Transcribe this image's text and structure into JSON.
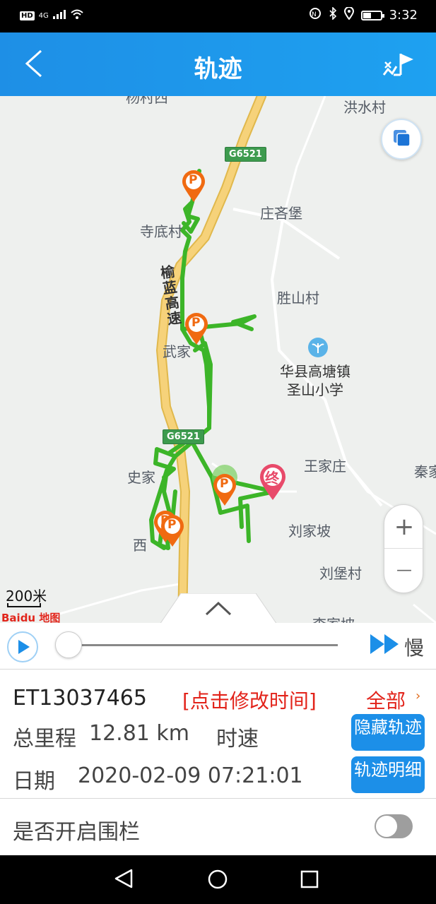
{
  "status_bar": {
    "left_badge": "HD",
    "network": "4G",
    "time": "3:32"
  },
  "header": {
    "title": "轨迹"
  },
  "map": {
    "road_code_1": "G6521",
    "road_code_2": "G6521",
    "highway_name": "榆蓝高速",
    "places": [
      {
        "name": "洪水村"
      },
      {
        "name": "庄吝堡"
      },
      {
        "name": "寺底村"
      },
      {
        "name": "胜山村"
      },
      {
        "name": "武家"
      },
      {
        "name": "华县高塘镇"
      },
      {
        "name": "圣山小学"
      },
      {
        "name": "史家"
      },
      {
        "name": "王家庄"
      },
      {
        "name": "秦家"
      },
      {
        "name": "刘家坡"
      },
      {
        "name": "西"
      },
      {
        "name": "刘堡村"
      },
      {
        "name": "李家坡"
      },
      {
        "name": "杨村西"
      }
    ],
    "scale": "200米",
    "logo": "Baidu 地图",
    "zoom_in": "+",
    "zoom_out": "—",
    "parking_marker": "P",
    "end_marker": "终",
    "track_color": "#3cb528",
    "parking_color": "#f06a11",
    "end_color": "#e84a6a"
  },
  "playback": {
    "speed_label": "慢",
    "progress": 0
  },
  "info": {
    "device_id": "ET13037465",
    "edit_time": "[点击修改时间]",
    "all_link": "全部",
    "mileage_label": "总里程",
    "mileage_value": "12.81 km",
    "speed_label": "时速",
    "date_label": "日期",
    "date_value": "2020-02-09 07:21:01",
    "hide_track_button": "隐藏轨迹",
    "track_detail_button": "轨迹明细"
  },
  "fence": {
    "label": "是否开启围栏",
    "enabled": false
  },
  "colors": {
    "header_blue": "#1e8fe6",
    "button_blue": "#1c8fe8",
    "accent_red": "#e2231a"
  }
}
